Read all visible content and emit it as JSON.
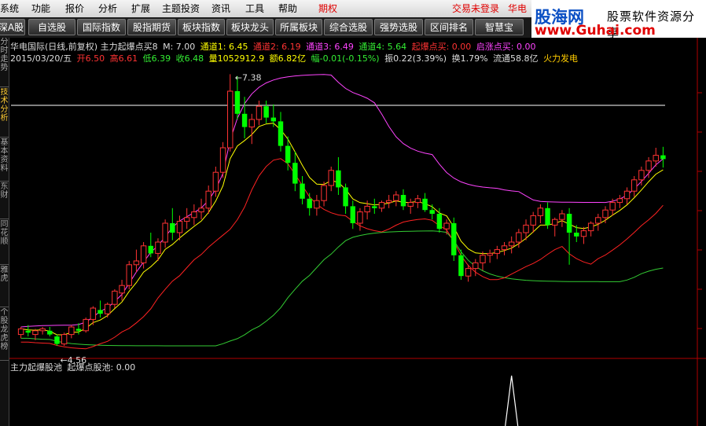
{
  "menu": {
    "items": [
      "系统",
      "功能",
      "报价",
      "分析",
      "扩展",
      "主题投资",
      "资讯",
      "工具",
      "帮助"
    ],
    "futures": "期权",
    "login_status": "交易未登录",
    "broker": "华电"
  },
  "watermark": {
    "site": "股海网",
    "slogan": "股票软件资源分享",
    "url": "www.Guhai.com"
  },
  "toolbar": {
    "items": [
      "深A股",
      "自选股",
      "国际指数",
      "股指期货",
      "板块指数",
      "板块龙头",
      "所属板块",
      "综合选股",
      "强势选股",
      "区间排名",
      "智慧宝"
    ]
  },
  "side_tabs": [
    "分时走势",
    "技术分析",
    "基本资料",
    "东财",
    "同花顺",
    "雅虎",
    "个股龙虎榜"
  ],
  "main_panel": {
    "title": "华电国际(日线,前复权) 主力起爆点买8",
    "m": "M: 7.00",
    "ch1": "通道1: 6.45",
    "ch2": "通道2: 6.19",
    "ch3": "通道3: 6.49",
    "ch4": "通道4: 5.64",
    "buy": "起爆点买: 0.00",
    "rise": "启涨点买: 0.00",
    "date": "2015/03/20/五",
    "open": "开6.50",
    "high": "高6.61",
    "low": "低6.39",
    "close": "收6.48",
    "vol": "量1052912.9",
    "amount": "额6.82亿",
    "change": "幅-0.01(-0.15%)",
    "amp": "振0.22(3.39%)",
    "turn": "换1.79%",
    "float": "流通58.8亿",
    "sector": "火力发电",
    "high_label": "7.38",
    "low_label": "4.56"
  },
  "sub_panel": {
    "title": "主力起爆股池",
    "value": "起爆点股池: 0.00"
  },
  "colors": {
    "up": "#ff3333",
    "down": "#00ff00",
    "yellow": "#ffff00",
    "magenta": "#ff44ff",
    "red_line": "#ff2222",
    "green_line": "#33cc33"
  },
  "chart_data": {
    "type": "candlestick",
    "ylim": [
      4.4,
      7.5
    ],
    "candles": [
      [
        4.62,
        4.7,
        4.58,
        4.68
      ],
      [
        4.66,
        4.72,
        4.6,
        4.64
      ],
      [
        4.62,
        4.68,
        4.56,
        4.66
      ],
      [
        4.66,
        4.7,
        4.62,
        4.68
      ],
      [
        4.66,
        4.7,
        4.6,
        4.62
      ],
      [
        4.6,
        4.62,
        4.5,
        4.52
      ],
      [
        4.52,
        4.64,
        4.5,
        4.62
      ],
      [
        4.62,
        4.72,
        4.58,
        4.7
      ],
      [
        4.68,
        4.74,
        4.62,
        4.66
      ],
      [
        4.66,
        4.8,
        4.64,
        4.78
      ],
      [
        4.78,
        4.92,
        4.72,
        4.9
      ],
      [
        4.88,
        4.98,
        4.8,
        4.84
      ],
      [
        4.84,
        4.96,
        4.8,
        4.94
      ],
      [
        4.94,
        5.1,
        4.9,
        5.08
      ],
      [
        5.06,
        5.2,
        4.98,
        5.14
      ],
      [
        5.14,
        5.4,
        5.1,
        5.36
      ],
      [
        5.36,
        5.52,
        5.28,
        5.4
      ],
      [
        5.38,
        5.6,
        5.32,
        5.56
      ],
      [
        5.56,
        5.7,
        5.44,
        5.48
      ],
      [
        5.48,
        5.64,
        5.4,
        5.6
      ],
      [
        5.6,
        5.84,
        5.54,
        5.8
      ],
      [
        5.8,
        5.96,
        5.62,
        5.7
      ],
      [
        5.7,
        5.88,
        5.62,
        5.82
      ],
      [
        5.82,
        5.96,
        5.74,
        5.86
      ],
      [
        5.86,
        6.0,
        5.78,
        5.92
      ],
      [
        5.92,
        6.06,
        5.84,
        5.96
      ],
      [
        5.96,
        6.2,
        5.9,
        6.14
      ],
      [
        6.14,
        6.4,
        6.08,
        6.34
      ],
      [
        6.34,
        6.66,
        6.28,
        6.6
      ],
      [
        6.6,
        7.38,
        6.56,
        7.2
      ],
      [
        7.2,
        7.36,
        6.9,
        6.96
      ],
      [
        6.96,
        7.14,
        6.7,
        6.82
      ],
      [
        6.82,
        6.96,
        6.64,
        6.9
      ],
      [
        6.9,
        7.1,
        6.84,
        7.04
      ],
      [
        7.04,
        7.1,
        6.86,
        6.92
      ],
      [
        6.92,
        7.06,
        6.82,
        6.88
      ],
      [
        6.88,
        6.98,
        6.56,
        6.62
      ],
      [
        6.62,
        6.72,
        6.36,
        6.44
      ],
      [
        6.44,
        6.56,
        6.14,
        6.22
      ],
      [
        6.22,
        6.3,
        6.0,
        6.06
      ],
      [
        6.06,
        6.12,
        5.88,
        5.96
      ],
      [
        5.96,
        6.1,
        5.88,
        6.04
      ],
      [
        6.04,
        6.24,
        5.98,
        6.2
      ],
      [
        6.2,
        6.4,
        6.14,
        6.36
      ],
      [
        6.36,
        6.5,
        6.1,
        6.18
      ],
      [
        6.18,
        6.22,
        5.9,
        5.98
      ],
      [
        5.98,
        6.04,
        5.74,
        5.8
      ],
      [
        5.8,
        5.96,
        5.72,
        5.92
      ],
      [
        5.92,
        6.04,
        5.84,
        5.98
      ],
      [
        5.98,
        6.06,
        5.9,
        5.96
      ],
      [
        5.96,
        6.04,
        5.92,
        6.02
      ],
      [
        6.02,
        6.1,
        5.96,
        6.04
      ],
      [
        6.04,
        6.14,
        5.98,
        6.1
      ],
      [
        6.1,
        6.16,
        5.94,
        5.98
      ],
      [
        5.98,
        6.06,
        5.9,
        6.02
      ],
      [
        6.02,
        6.1,
        5.96,
        6.06
      ],
      [
        6.06,
        6.12,
        5.92,
        5.94
      ],
      [
        5.94,
        6.0,
        5.84,
        5.9
      ],
      [
        5.9,
        5.96,
        5.7,
        5.74
      ],
      [
        5.74,
        5.84,
        5.68,
        5.8
      ],
      [
        5.8,
        5.86,
        5.4,
        5.46
      ],
      [
        5.46,
        5.52,
        5.2,
        5.24
      ],
      [
        5.24,
        5.36,
        5.18,
        5.32
      ],
      [
        5.32,
        5.42,
        5.24,
        5.38
      ],
      [
        5.38,
        5.5,
        5.3,
        5.46
      ],
      [
        5.46,
        5.52,
        5.38,
        5.48
      ],
      [
        5.48,
        5.56,
        5.42,
        5.52
      ],
      [
        5.52,
        5.6,
        5.46,
        5.56
      ],
      [
        5.56,
        5.66,
        5.48,
        5.6
      ],
      [
        5.6,
        5.74,
        5.54,
        5.7
      ],
      [
        5.7,
        5.84,
        5.62,
        5.78
      ],
      [
        5.78,
        5.92,
        5.7,
        5.88
      ],
      [
        5.88,
        6.0,
        5.8,
        5.96
      ],
      [
        5.96,
        6.02,
        5.74,
        5.78
      ],
      [
        5.78,
        5.86,
        5.66,
        5.84
      ],
      [
        5.84,
        5.94,
        5.76,
        5.9
      ],
      [
        5.9,
        5.96,
        5.36,
        5.7
      ],
      [
        5.7,
        5.78,
        5.6,
        5.66
      ],
      [
        5.66,
        5.76,
        5.58,
        5.72
      ],
      [
        5.72,
        5.82,
        5.66,
        5.8
      ],
      [
        5.8,
        5.9,
        5.72,
        5.86
      ],
      [
        5.86,
        5.98,
        5.8,
        5.94
      ],
      [
        5.94,
        6.06,
        5.88,
        6.02
      ],
      [
        6.02,
        6.1,
        5.96,
        6.06
      ],
      [
        6.06,
        6.18,
        6.0,
        6.14
      ],
      [
        6.14,
        6.3,
        6.08,
        6.26
      ],
      [
        6.26,
        6.4,
        6.2,
        6.36
      ],
      [
        6.36,
        6.5,
        6.28,
        6.46
      ],
      [
        6.46,
        6.6,
        6.4,
        6.52
      ],
      [
        6.52,
        6.61,
        6.39,
        6.48
      ]
    ],
    "sub_signal_index": 68
  }
}
